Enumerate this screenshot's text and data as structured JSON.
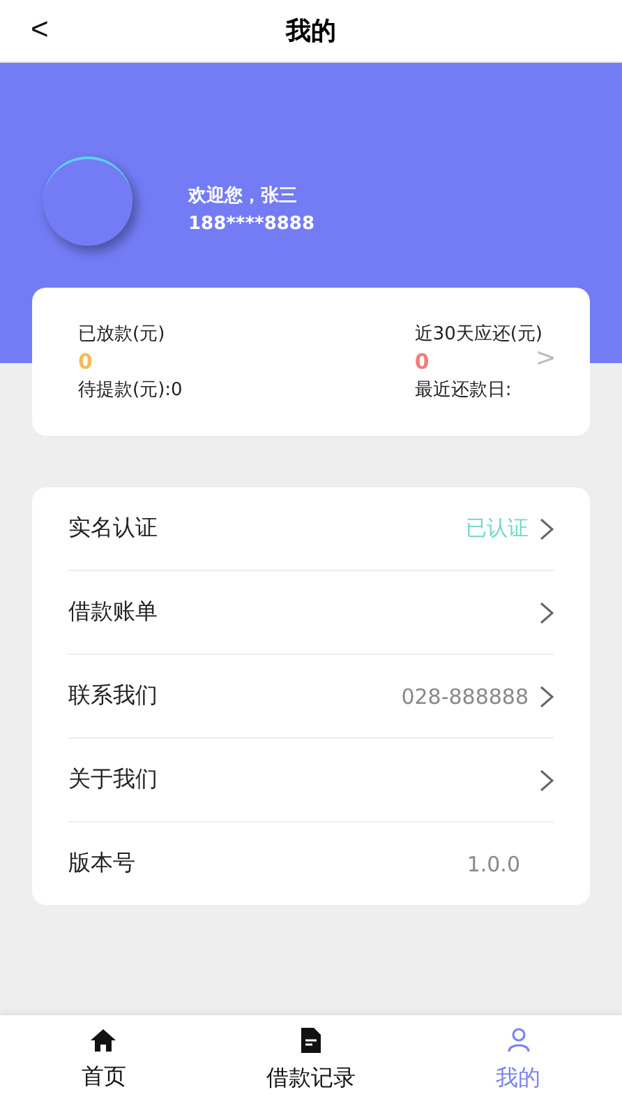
{
  "header": {
    "back": "<",
    "title": "我的"
  },
  "profile": {
    "greeting": "欢迎您，张三",
    "phone": "188****8888"
  },
  "summary": {
    "left": {
      "label": "已放款(元)",
      "amount": "0",
      "color": "#f6bb55",
      "sub": "待提款(元):0"
    },
    "right": {
      "label": "近30天应还(元)",
      "amount": "0",
      "color": "#f27c7c",
      "sub": "最近还款日:"
    },
    "arrow": ">"
  },
  "menu": [
    {
      "label": "实名认证",
      "value": "已认证",
      "color": "#6fd9c8",
      "arrow": true
    },
    {
      "label": "借款账单",
      "arrow": true
    },
    {
      "label": "联系我们",
      "value": "028-888888",
      "color": "#888888",
      "arrow": true
    },
    {
      "label": "关于我们",
      "arrow": true
    },
    {
      "label": "版本号",
      "value": "1.0.0",
      "color": "#888888",
      "arrow": false
    }
  ],
  "tabs": [
    {
      "label": "首页",
      "kind": "home",
      "selected": false
    },
    {
      "label": "借款记录",
      "kind": "document",
      "selected": false
    },
    {
      "label": "我的",
      "kind": "user",
      "selected": true
    }
  ]
}
